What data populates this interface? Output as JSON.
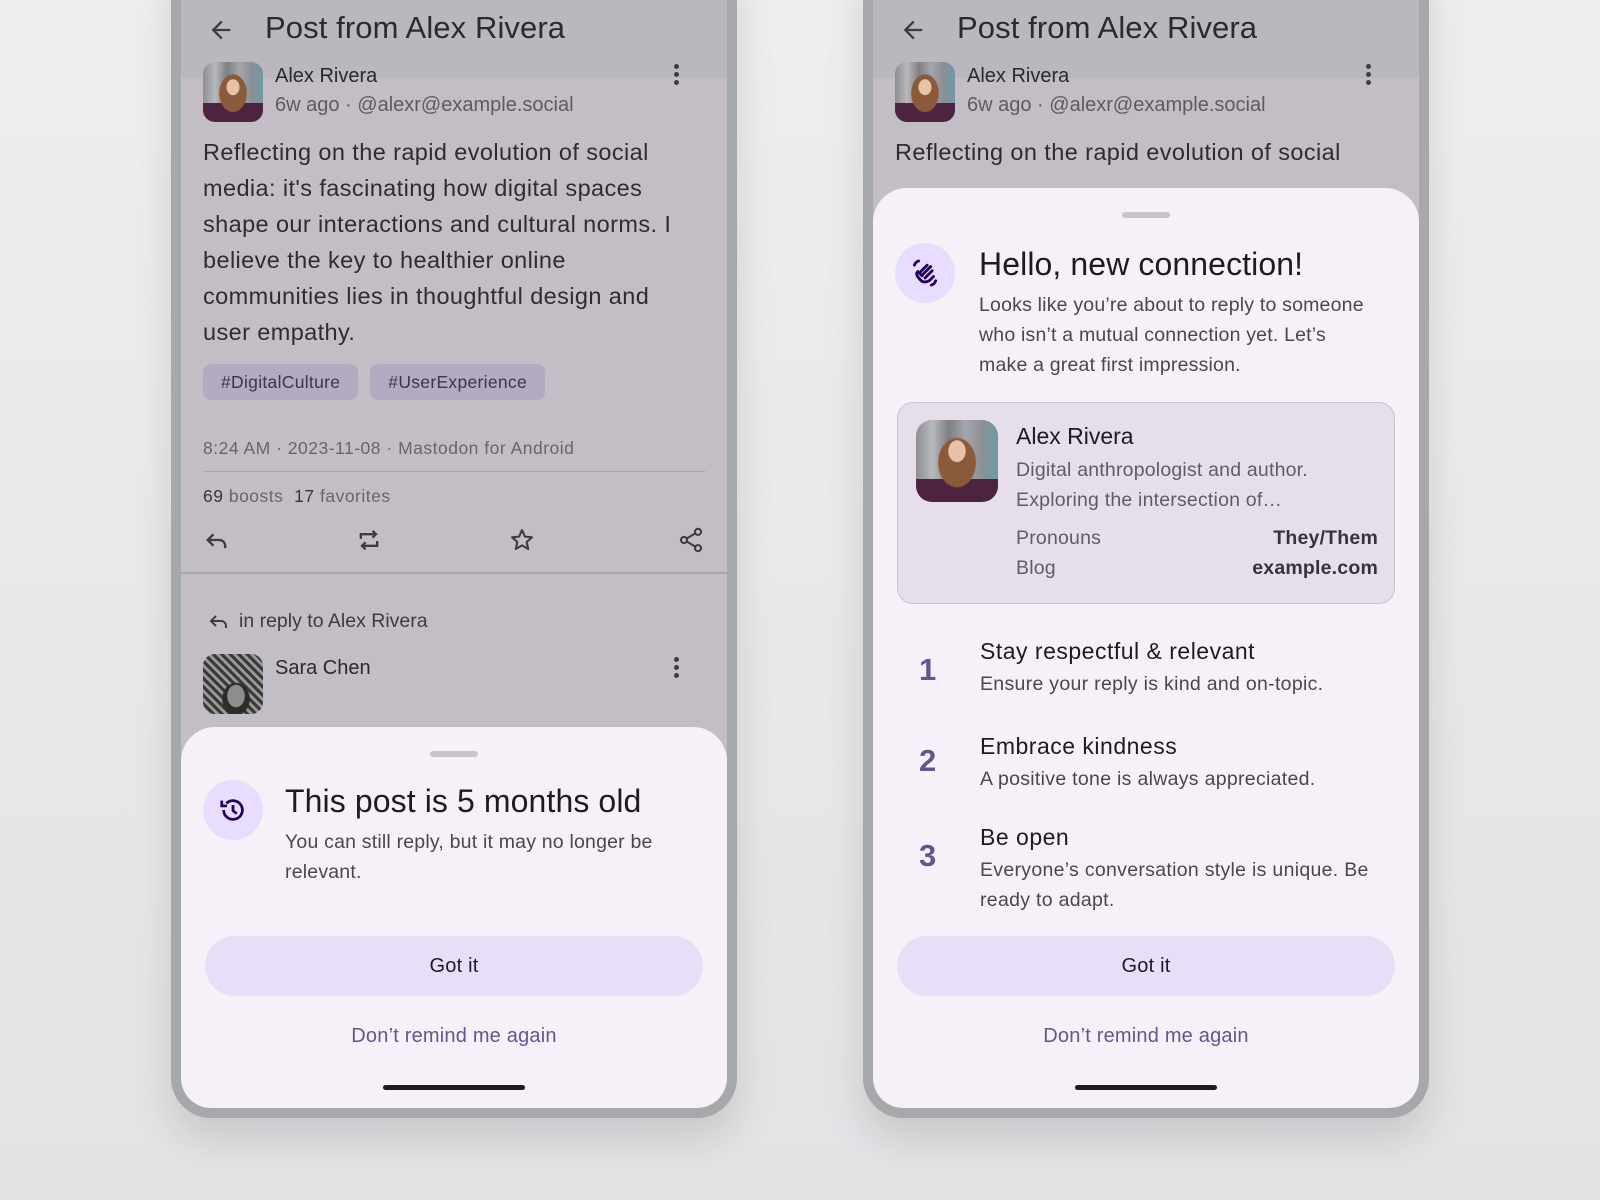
{
  "colors": {
    "accent": "#65558f",
    "tonal_button": "#e8def8",
    "icon_container": "#e9ddff",
    "sheet_surface": "#f6f1f9",
    "scrim_surface": "#c3bec6"
  },
  "left": {
    "appbar": {
      "back_icon": "arrow-back-icon",
      "title": "Post from Alex Rivera"
    },
    "post": {
      "author": "Alex Rivera",
      "meta": "6w ago · @alexr@example.social",
      "body": "Reflecting on the rapid evolution of social media: it's fascinating how digital spaces shape our interactions and cultural norms. I believe the key to healthier online communities lies in thoughtful design and user empathy.",
      "tags": [
        "#DigitalCulture",
        "#UserExperience"
      ],
      "time": "8:24 AM",
      "date": "2023-11-08",
      "client": "Mastodon for Android",
      "boosts_count": "69",
      "boosts_label": "boosts",
      "favorites_count": "17",
      "favorites_label": "favorites",
      "actions": [
        "reply-icon",
        "boost-icon",
        "favorite-icon",
        "share-icon"
      ]
    },
    "reply_context": "in reply to Alex Rivera",
    "reply_author": "Sara Chen",
    "sheet": {
      "icon": "history-icon",
      "title": "This post is 5 months old",
      "description": "You can still reply, but it may no longer be relevant.",
      "primary": "Got it",
      "secondary": "Don’t remind me again"
    }
  },
  "right": {
    "appbar": {
      "back_icon": "arrow-back-icon",
      "title": "Post from Alex Rivera"
    },
    "post": {
      "author": "Alex Rivera",
      "meta": "6w ago · @alexr@example.social",
      "peek_text": "Reflecting on the rapid evolution of social"
    },
    "sheet": {
      "icon": "waving-hand-icon",
      "title": "Hello, new connection!",
      "description": "Looks like you’re about to reply to someone who isn’t a mutual connection yet. Let’s make a great first impression.",
      "profile": {
        "name": "Alex Rivera",
        "bio": "Digital anthropologist and author. Exploring the intersection of…",
        "fields": [
          {
            "label": "Pronouns",
            "value": "They/Them"
          },
          {
            "label": "Blog",
            "value": "example.com"
          }
        ]
      },
      "tips": [
        {
          "number": "1",
          "title": "Stay respectful & relevant",
          "description": "Ensure your reply is kind and on-topic."
        },
        {
          "number": "2",
          "title": "Embrace kindness",
          "description": "A positive tone is always appreciated."
        },
        {
          "number": "3",
          "title": "Be open",
          "description": "Everyone’s conversation style is unique. Be ready to adapt."
        }
      ],
      "primary": "Got it",
      "secondary": "Don’t remind me again"
    }
  }
}
